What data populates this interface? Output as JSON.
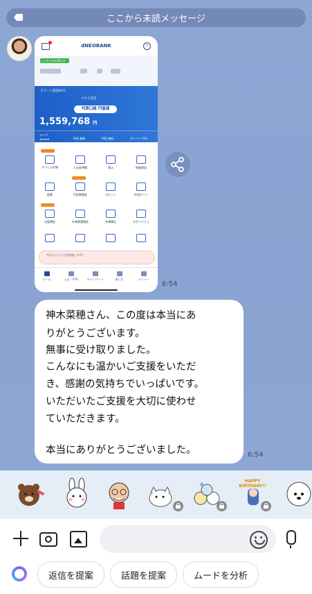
{
  "banner": {
    "unread_label": "ここから未読メッセージ"
  },
  "screenshot": {
    "bank_logo": "dNEOBANK",
    "greeting_badge": "○○からのお知らせ",
    "smart_app": "スマート認証NEO",
    "branch": "バナナ支店",
    "account_type": "代表口座 円普通",
    "balance": "1,559,768",
    "currency": "円",
    "rank_label": "ランク",
    "rank_stars": "★★★★",
    "row_values": [
      "19回 無料",
      "19回 無料",
      "ポイント 612"
    ],
    "icons": [
      "アプリでATM",
      "入出金明細",
      "振込",
      "残高照会",
      "振替",
      "円定期預金",
      "デビット",
      "住宅ローン",
      "仕組預金",
      "外貨普通預金",
      "外貨積立",
      "スポーツくじ"
    ],
    "search_hint": "今月コンビニで何金使いすぎ？",
    "nav": [
      "ホーム",
      "入出・ATM",
      "キャンペーン",
      "使い方",
      "メニュー"
    ]
  },
  "timestamps": {
    "image_time": "6:54",
    "message_time": "6:54"
  },
  "message": {
    "lines": [
      "神木菜穂さん、この度は本当にあ",
      "りがとうございます。",
      "無事に受け取りました。",
      "こんなにも温かいご支援をいただ",
      "き、感謝の気持ちでいっぱいです。",
      "いただいたご支援を大切に使わせ",
      "ていただきます。",
      "",
      "本当にありがとうございました。"
    ]
  },
  "sticker_text": "HAPPY BIRTHDAY!!",
  "suggestions": [
    "返信を提案",
    "話題を提案",
    "ムードを分析"
  ],
  "icons": [
    "plus-icon",
    "camera-icon",
    "image-icon",
    "emoji-icon",
    "mic-icon",
    "share-icon",
    "ai-assistant-icon",
    "lock-icon"
  ]
}
